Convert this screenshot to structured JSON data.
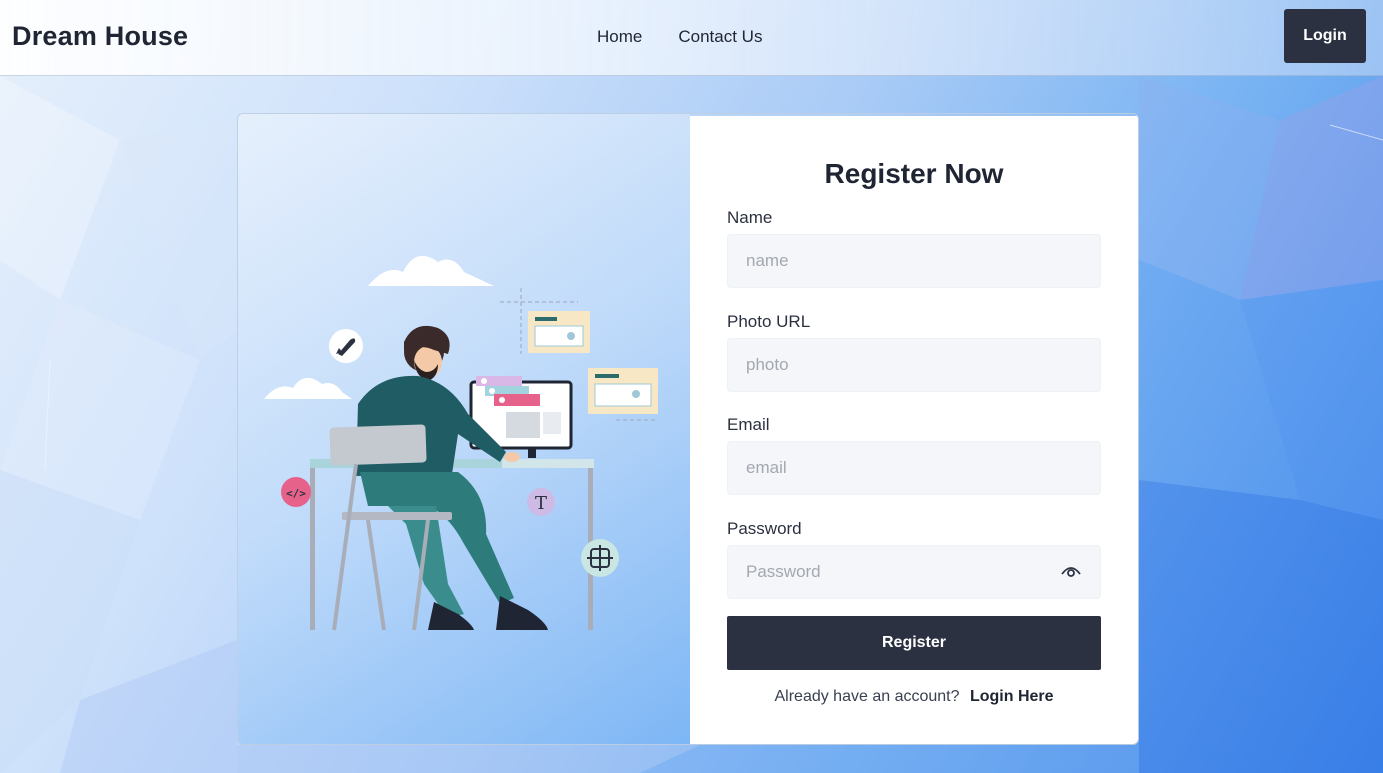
{
  "app": {
    "brand": "Dream House"
  },
  "nav": {
    "links": [
      "Home",
      "Contact Us"
    ],
    "login_label": "Login"
  },
  "form": {
    "title": "Register Now",
    "fields": [
      {
        "label": "Name",
        "placeholder": "name",
        "type": "text"
      },
      {
        "label": "Photo URL",
        "placeholder": "photo",
        "type": "text"
      },
      {
        "label": "Email",
        "placeholder": "email",
        "type": "email"
      },
      {
        "label": "Password",
        "placeholder": "Password",
        "type": "password"
      }
    ],
    "password_toggle_icon": "eye-icon",
    "submit_label": "Register",
    "already_text": "Already have an account?",
    "login_link": "Login Here"
  },
  "illustration": {
    "subject": "person-at-desk-computer",
    "badges": [
      "T"
    ]
  },
  "colors": {
    "primary_dark": "#2b3140",
    "input_bg": "#f4f6f9",
    "teal": "#1f5c63",
    "pink": "#e7628b"
  }
}
